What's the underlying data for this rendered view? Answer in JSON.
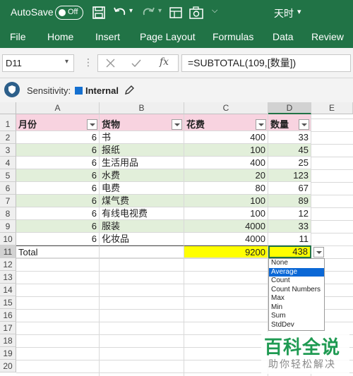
{
  "titlebar": {
    "autosave_label": "AutoSave",
    "autosave_state": "Off",
    "user_name": "天时",
    "bg_color": "#217346"
  },
  "menu": [
    "File",
    "Home",
    "Insert",
    "Page Layout",
    "Formulas",
    "Data",
    "Review"
  ],
  "formula_bar": {
    "name_box": "D11",
    "formula": "=SUBTOTAL(109,[数量])",
    "fx_label": "fx"
  },
  "sensitivity": {
    "label": "Sensitivity:",
    "value": "Internal"
  },
  "columns": [
    "A",
    "B",
    "C",
    "D",
    "E"
  ],
  "rows": [
    "1",
    "2",
    "3",
    "4",
    "5",
    "6",
    "7",
    "8",
    "9",
    "10",
    "11",
    "12",
    "13",
    "14",
    "15",
    "16",
    "17",
    "18",
    "19",
    "20"
  ],
  "table": {
    "headers": [
      "月份",
      "货物",
      "花费",
      "数量"
    ],
    "data": [
      [
        "6",
        "书",
        "400",
        "33"
      ],
      [
        "6",
        "报纸",
        "100",
        "45"
      ],
      [
        "6",
        "生活用品",
        "400",
        "25"
      ],
      [
        "6",
        "水费",
        "20",
        "123"
      ],
      [
        "6",
        "电费",
        "80",
        "67"
      ],
      [
        "6",
        "煤气费",
        "100",
        "89"
      ],
      [
        "6",
        "有线电视费",
        "100",
        "12"
      ],
      [
        "6",
        "服装",
        "4000",
        "33"
      ],
      [
        "6",
        "化妆品",
        "4000",
        "11"
      ]
    ],
    "total_label": "Total",
    "total_cost": "9200",
    "total_qty": "438"
  },
  "dropdown": {
    "options": [
      "None",
      "Average",
      "Count",
      "Count Numbers",
      "Max",
      "Min",
      "Sum",
      "StdDev"
    ],
    "selected": "Average"
  },
  "watermark": {
    "title": "百科全说",
    "subtitle": "助你轻松解决"
  },
  "colors": {
    "header_pink": "#f8d3e0",
    "band_green": "#e2efda",
    "total_yellow": "#ffff00",
    "highlight_blue": "#0b68d6"
  }
}
